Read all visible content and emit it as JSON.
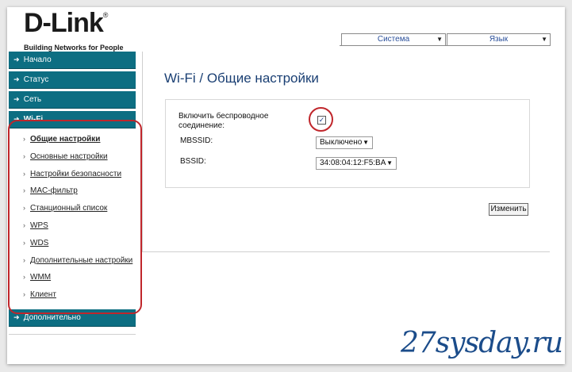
{
  "logo": {
    "brand": "D-Link",
    "tagline": "Building Networks for People"
  },
  "header": {
    "system_menu": "Система",
    "language_menu": "Язык"
  },
  "sidebar": {
    "items": [
      {
        "label": "Начало"
      },
      {
        "label": "Статус"
      },
      {
        "label": "Сеть"
      },
      {
        "label": "Wi-Fi"
      }
    ],
    "wifi_subitems": [
      {
        "label": "Общие настройки"
      },
      {
        "label": "Основные настройки"
      },
      {
        "label": "Настройки безопасности"
      },
      {
        "label": "MAC-фильтр"
      },
      {
        "label": "Станционный список"
      },
      {
        "label": "WPS"
      },
      {
        "label": "WDS"
      },
      {
        "label": "Дополнительные настройки"
      },
      {
        "label": "WMM"
      },
      {
        "label": "Клиент"
      }
    ],
    "extra": {
      "label": "Дополнительно"
    }
  },
  "main": {
    "title": "Wi-Fi /  Общие настройки",
    "enable_wireless_label_line1": "Включить беспроводное",
    "enable_wireless_label_line2": "соединение:",
    "enable_wireless_checked": true,
    "mbssid_label": "MBSSID:",
    "mbssid_value": "Выключено",
    "bssid_label": "BSSID:",
    "bssid_value": "34:08:04:12:F5:BA",
    "change_button": "Изменить"
  },
  "watermark": "27sysday.ru",
  "colors": {
    "nav": "#0d6e82",
    "title": "#1a3f73",
    "highlight": "#c0262b"
  }
}
